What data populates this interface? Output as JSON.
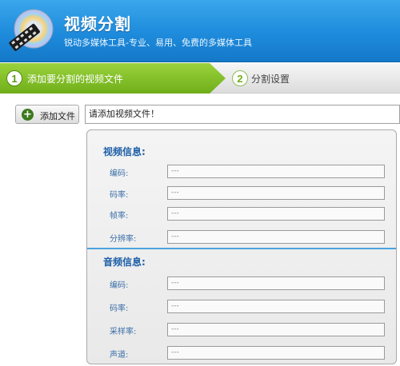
{
  "header": {
    "title": "视频分割",
    "subtitle": "锐动多媒体工具-专业、易用、免费的多媒体工具"
  },
  "steps": [
    {
      "number": "1",
      "label": "添加要分割的视频文件",
      "active": true
    },
    {
      "number": "2",
      "label": "分割设置",
      "active": false
    }
  ],
  "file": {
    "add_button_label": "添加文件",
    "input_value": "请添加视频文件！"
  },
  "video_info": {
    "title": "视频信息:",
    "fields": [
      {
        "label": "编码:",
        "value": "---"
      },
      {
        "label": "码率:",
        "value": "---"
      },
      {
        "label": "帧率:",
        "value": "---"
      },
      {
        "label": "分辨率:",
        "value": "---"
      }
    ]
  },
  "audio_info": {
    "title": "音频信息:",
    "fields": [
      {
        "label": "编码:",
        "value": "---"
      },
      {
        "label": "码率:",
        "value": "---"
      },
      {
        "label": "采样率:",
        "value": "---"
      },
      {
        "label": "声道:",
        "value": "---"
      }
    ]
  },
  "colors": {
    "header_blue": "#1e8bdc",
    "step_green": "#6fae1a",
    "section_title": "#1d5fa8"
  }
}
